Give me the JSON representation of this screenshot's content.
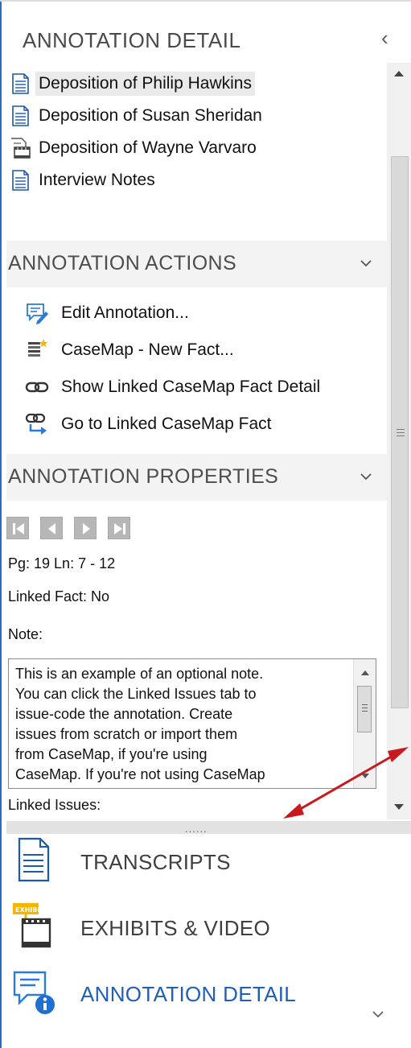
{
  "header": {
    "title": "ANNOTATION DETAIL",
    "collapse_icon": "chevron-left-icon"
  },
  "documents": [
    {
      "label": "Deposition of Philip Hawkins",
      "icon": "transcript-icon",
      "selected": true
    },
    {
      "label": "Deposition of Susan Sheridan",
      "icon": "transcript-icon",
      "selected": false
    },
    {
      "label": "Deposition of Wayne Varvaro",
      "icon": "video-transcript-icon",
      "selected": false
    },
    {
      "label": "Interview Notes",
      "icon": "transcript-icon",
      "selected": false
    }
  ],
  "actions_section": {
    "title": "ANNOTATION ACTIONS",
    "items": [
      {
        "label": "Edit Annotation...",
        "icon": "edit-annotation-icon"
      },
      {
        "label": "CaseMap - New Fact...",
        "icon": "new-fact-icon"
      },
      {
        "label": "Show Linked CaseMap Fact Detail",
        "icon": "link-icon"
      },
      {
        "label": "Go to Linked CaseMap Fact",
        "icon": "go-to-link-icon"
      }
    ]
  },
  "properties_section": {
    "title": "ANNOTATION PROPERTIES",
    "nav_buttons": [
      "first-record-icon",
      "previous-record-icon",
      "next-record-icon",
      "last-record-icon"
    ],
    "page_line": "Pg: 19 Ln: 7 - 12",
    "linked_fact": "Linked Fact: No",
    "note_label": "Note:",
    "note_lines": [
      "This is an example of an optional note.",
      "You can click the Linked Issues tab to",
      "issue-code the annotation. Create",
      "issues from scratch or import them",
      "from CaseMap, if you're using",
      "CaseMap.  If you're not using CaseMap"
    ],
    "linked_issues_label": "Linked Issues:"
  },
  "splitter": {
    "grip": "......"
  },
  "bottom_nav": [
    {
      "label": "TRANSCRIPTS",
      "icon": "transcripts-icon",
      "active": false
    },
    {
      "label": "EXHIBITS & VIDEO",
      "icon": "exhibits-video-icon",
      "badge": "EXHIBIT",
      "active": false
    },
    {
      "label": "ANNOTATION DETAIL",
      "icon": "annotation-detail-icon",
      "active": true
    }
  ],
  "colors": {
    "accent": "#1f5fb8",
    "arrow": "#c8191e",
    "section_bg": "#f3f3f3"
  }
}
